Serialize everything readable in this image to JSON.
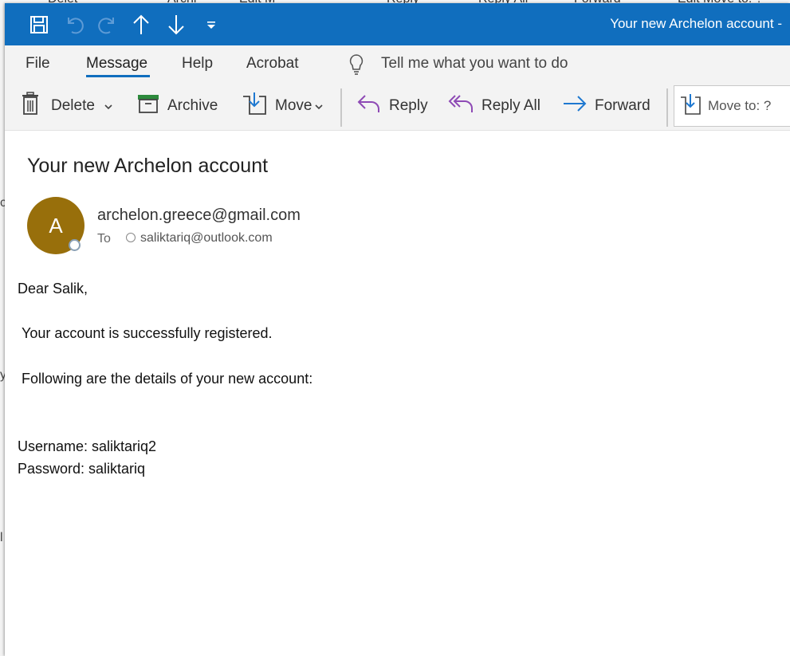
{
  "window": {
    "title": "Your new Archelon account -"
  },
  "background": {
    "strip_labels": [
      "Delet",
      "Archi",
      "Edit M",
      "Reply",
      "Reply All",
      "Forward",
      "Edit Move to: ?"
    ],
    "edge_glyphs": [
      "c",
      "y",
      "l"
    ]
  },
  "quick_access": {
    "icons": [
      "save-icon",
      "undo-icon",
      "redo-icon",
      "up-arrow-icon",
      "down-arrow-icon",
      "customize-icon"
    ]
  },
  "menu": {
    "items": [
      "File",
      "Message",
      "Help",
      "Acrobat"
    ],
    "tell_me": "Tell me what you want to do",
    "active": "Message"
  },
  "ribbon": {
    "delete": "Delete",
    "archive": "Archive",
    "move": "Move",
    "reply": "Reply",
    "reply_all": "Reply All",
    "forward": "Forward",
    "move_to": "Move to: ?"
  },
  "email": {
    "subject": "Your new Archelon account",
    "avatar_initial": "A",
    "avatar_color": "#986f0b",
    "sender": "archelon.greece@gmail.com",
    "to_label": "To",
    "recipient": "saliktariq@outlook.com",
    "greeting": "Dear Salik,",
    "line1": "Your account is successfully registered.",
    "line2": "Following are the details of your new account:",
    "username": "Username: saliktariq2",
    "password": "Password: saliktariq"
  },
  "colors": {
    "titlebar": "#106ebe",
    "reply_purple": "#8e4ab5",
    "forward_blue": "#1e78d0",
    "archive_green": "#2c8a3c"
  }
}
